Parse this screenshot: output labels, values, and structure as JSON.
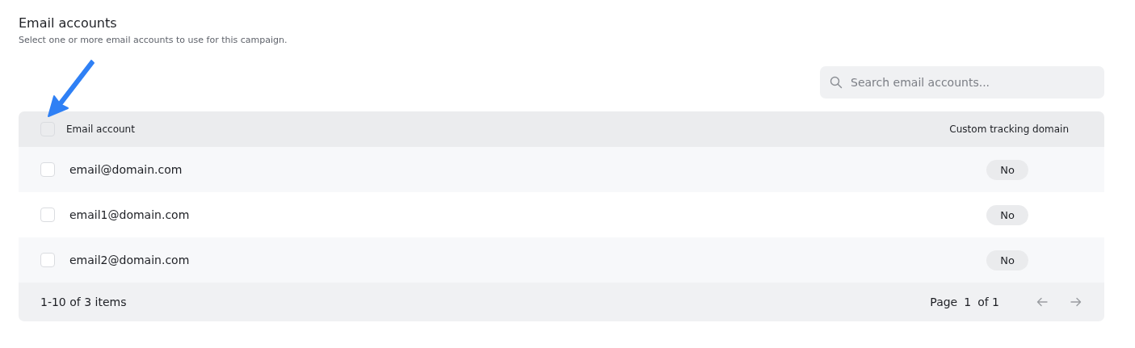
{
  "section": {
    "title": "Email accounts",
    "subtitle": "Select one or more email accounts to use for this campaign."
  },
  "search": {
    "placeholder": "Search email accounts..."
  },
  "table": {
    "select_all": {
      "checked": false
    },
    "columns": [
      "Email account",
      "Custom tracking domain"
    ],
    "rows": [
      {
        "checked": false,
        "email": "email@domain.com",
        "tracking": "No"
      },
      {
        "checked": false,
        "email": "email1@domain.com",
        "tracking": "No"
      },
      {
        "checked": false,
        "email": "email2@domain.com",
        "tracking": "No"
      }
    ]
  },
  "footer": {
    "range": "1-10 of 3 items",
    "page_label": "Page",
    "page": "1",
    "page_total": "of 1"
  }
}
